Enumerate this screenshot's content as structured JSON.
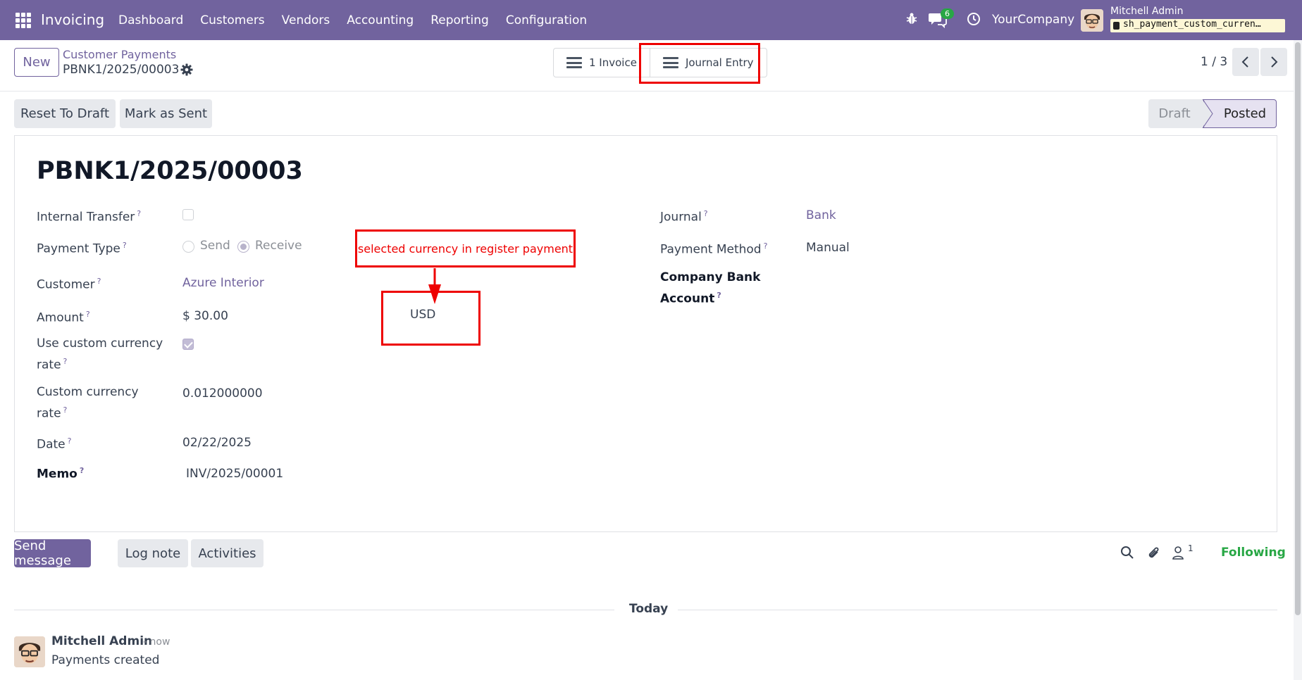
{
  "app": {
    "name": "Invoicing",
    "menu": [
      "Dashboard",
      "Customers",
      "Vendors",
      "Accounting",
      "Reporting",
      "Configuration"
    ],
    "chat_count": "6",
    "company": "YourCompany",
    "user": "Mitchell Admin",
    "db_name": "sh_payment_custom_curren…"
  },
  "control": {
    "new_label": "New",
    "breadcrumb_parent": "Customer Payments",
    "breadcrumb_current": "PBNK1/2025/00003",
    "smart_invoice": "1 Invoice",
    "smart_journal": "Journal Entry",
    "pager": "1 / 3"
  },
  "status": {
    "reset_label": "Reset To Draft",
    "sent_label": "Mark as Sent",
    "stages": [
      "Draft",
      "Posted"
    ],
    "current_stage": "Posted"
  },
  "form": {
    "title": "PBNK1/2025/00003",
    "internal_transfer_label": "Internal Transfer",
    "internal_transfer": false,
    "payment_type_label": "Payment Type",
    "payment_type_options": [
      "Send",
      "Receive"
    ],
    "payment_type_selected": "Receive",
    "customer_label": "Customer",
    "customer": "Azure Interior",
    "amount_label": "Amount",
    "amount": "$ 30.00",
    "currency": "USD",
    "custom_rate_toggle_label_1": "Use custom currency",
    "custom_rate_toggle_label_2": "rate",
    "custom_rate_toggle": true,
    "custom_rate_label_1": "Custom currency",
    "custom_rate_label_2": "rate",
    "custom_rate": "0.012000000",
    "date_label": "Date",
    "date": "02/22/2025",
    "memo_label": "Memo",
    "memo": "INV/2025/00001",
    "journal_label": "Journal",
    "journal": "Bank",
    "payment_method_label": "Payment Method",
    "payment_method": "Manual",
    "bank_account_label_1": "Company Bank",
    "bank_account_label_2": "Account",
    "help_mark": "?"
  },
  "annotation": {
    "text": "selected currency in register payment",
    "color": "#ee0000"
  },
  "chatter": {
    "send_message": "Send message",
    "log_note": "Log note",
    "activities": "Activities",
    "followers_count": "1",
    "following": "Following",
    "today": "Today",
    "author": "Mitchell Admin",
    "time": "- now",
    "body": "Payments created"
  },
  "colors": {
    "brand": "#71639e",
    "following": "#28a745",
    "annotation": "#ee0000"
  }
}
